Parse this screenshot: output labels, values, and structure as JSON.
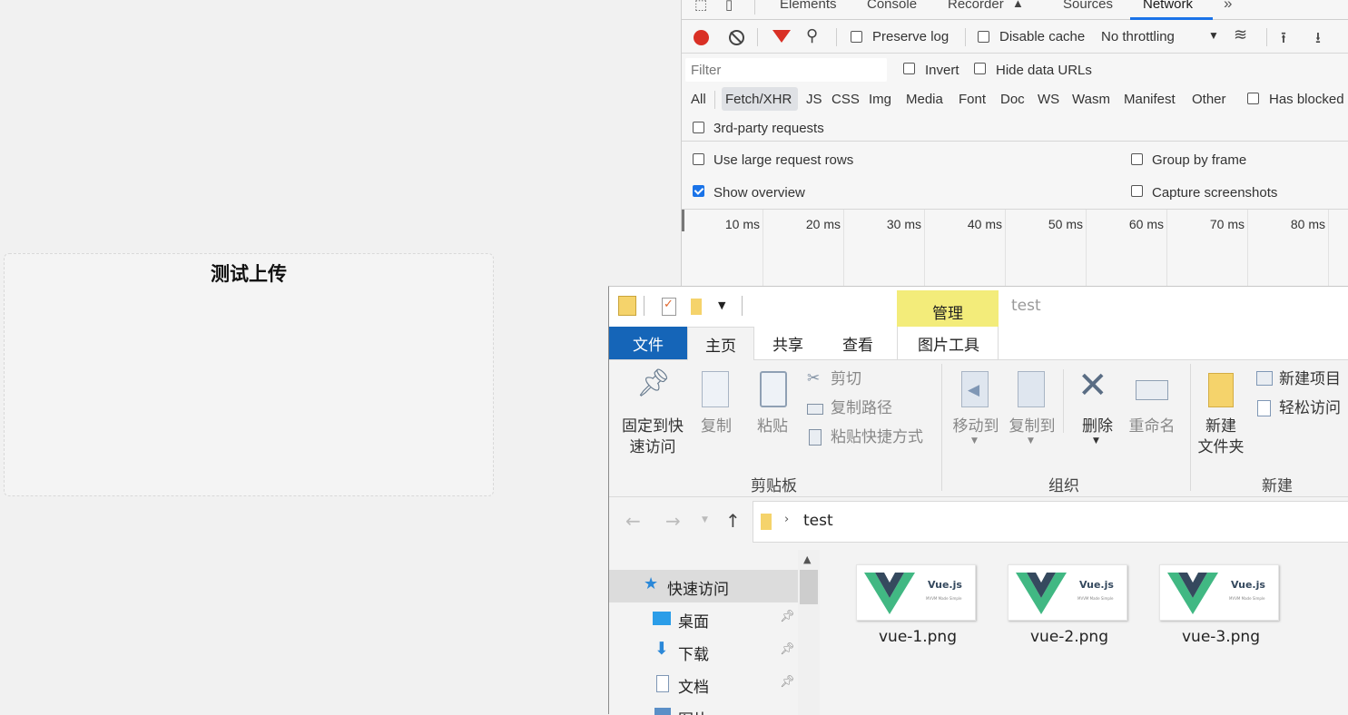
{
  "page": {
    "upload_title": "测试上传"
  },
  "devtools": {
    "tabs": [
      "Elements",
      "Console",
      "Recorder",
      "Sources",
      "Network"
    ],
    "toolbar": {
      "preserve_log": "Preserve log",
      "disable_cache": "Disable cache",
      "throttling": "No throttling"
    },
    "filter": {
      "placeholder": "Filter",
      "invert": "Invert",
      "hide_data_urls": "Hide data URLs"
    },
    "types": [
      "All",
      "Fetch/XHR",
      "JS",
      "CSS",
      "Img",
      "Media",
      "Font",
      "Doc",
      "WS",
      "Wasm",
      "Manifest",
      "Other"
    ],
    "has_blocked": "Has blocked",
    "third_party": "3rd-party requests",
    "options": {
      "large_rows": "Use large request rows",
      "group_by_frame": "Group by frame",
      "show_overview": "Show overview",
      "capture_screenshots": "Capture screenshots"
    },
    "timeline_ticks": [
      "10 ms",
      "20 ms",
      "30 ms",
      "40 ms",
      "50 ms",
      "60 ms",
      "70 ms",
      "80 ms"
    ]
  },
  "explorer": {
    "context_tab": "管理",
    "window_title": "test",
    "ribbon_tabs": [
      "文件",
      "主页",
      "共享",
      "查看",
      "图片工具"
    ],
    "buttons": {
      "pin_line1": "固定到快",
      "pin_line2": "速访问",
      "copy": "复制",
      "paste": "粘贴",
      "cut": "剪切",
      "copy_path": "复制路径",
      "paste_shortcut": "粘贴快捷方式",
      "move_to": "移动到",
      "copy_to": "复制到",
      "delete": "删除",
      "rename": "重命名",
      "new_folder_line1": "新建",
      "new_folder_line2": "文件夹",
      "new_item": "新建项目",
      "easy_access": "轻松访问"
    },
    "groups": {
      "clipboard": "剪贴板",
      "organize": "组织",
      "new": "新建"
    },
    "address": "test",
    "nav": [
      "快速访问",
      "桌面",
      "下载",
      "文档",
      "图片"
    ],
    "files": [
      {
        "name": "vue-1.png",
        "thumb_title": "Vue.js",
        "thumb_sub": "MVVM Made Simple"
      },
      {
        "name": "vue-2.png",
        "thumb_title": "Vue.js",
        "thumb_sub": "MVVM Made Simple"
      },
      {
        "name": "vue-3.png",
        "thumb_title": "Vue.js",
        "thumb_sub": "MVVM Made Simple"
      }
    ],
    "colors": {
      "file_tab": "#1565b8",
      "manage_tab": "#f3ec7a",
      "vue_green": "#41b883",
      "vue_dark": "#35495e"
    }
  }
}
